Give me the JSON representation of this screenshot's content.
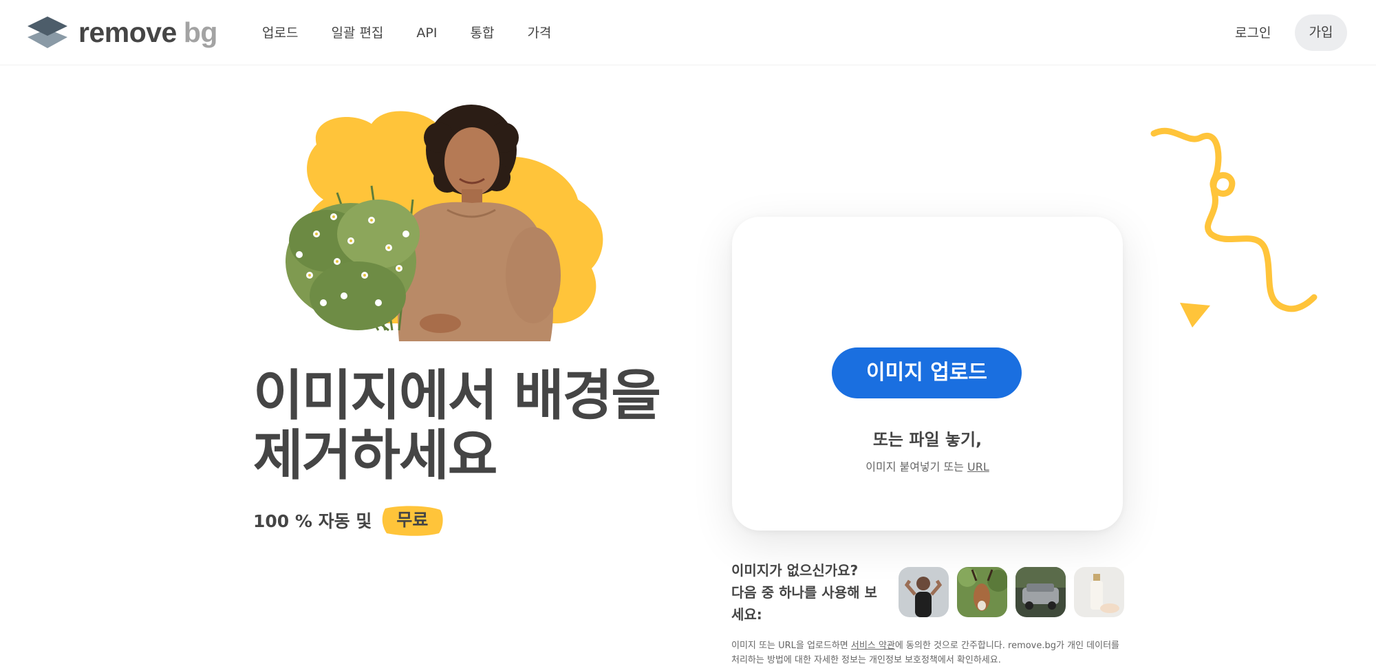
{
  "header": {
    "logo": {
      "name": "remove",
      "suffix": "bg"
    },
    "nav": [
      "업로드",
      "일괄 편집",
      "API",
      "통합",
      "가격"
    ],
    "login_label": "로그인",
    "signup_label": "가입"
  },
  "hero": {
    "title_line1": "이미지에서 배경을",
    "title_line2": "제거하세요",
    "subtitle_prefix": "100 % 자동 및",
    "subtitle_badge": "무료"
  },
  "upload_card": {
    "button_label": "이미지 업로드",
    "drop_title": "또는 파일 놓기,",
    "drop_sub_prefix": "이미지 붙여넣기 또는",
    "drop_sub_link": "URL"
  },
  "samples": {
    "prompt_line1": "이미지가 없으신가요?",
    "prompt_line2": "다음 중 하나를 사용해 보",
    "prompt_line3": "세요:",
    "thumbnails": [
      "woman-flexing",
      "antelope",
      "car",
      "cosmetic-bottle"
    ]
  },
  "terms": {
    "before_link": "이미지 또는 URL을 업로드하면 ",
    "link": "서비스 약관",
    "after_link": "에 동의한 것으로 간주합니다. remove.bg가 개인 데이터를",
    "line2": "처리하는 방법에 대한 자세한 정보는 개인정보 보호정책에서 확인하세요."
  },
  "colors": {
    "accent_blue": "#1a6fe0",
    "accent_yellow": "#ffc43a",
    "text": "#454545"
  }
}
